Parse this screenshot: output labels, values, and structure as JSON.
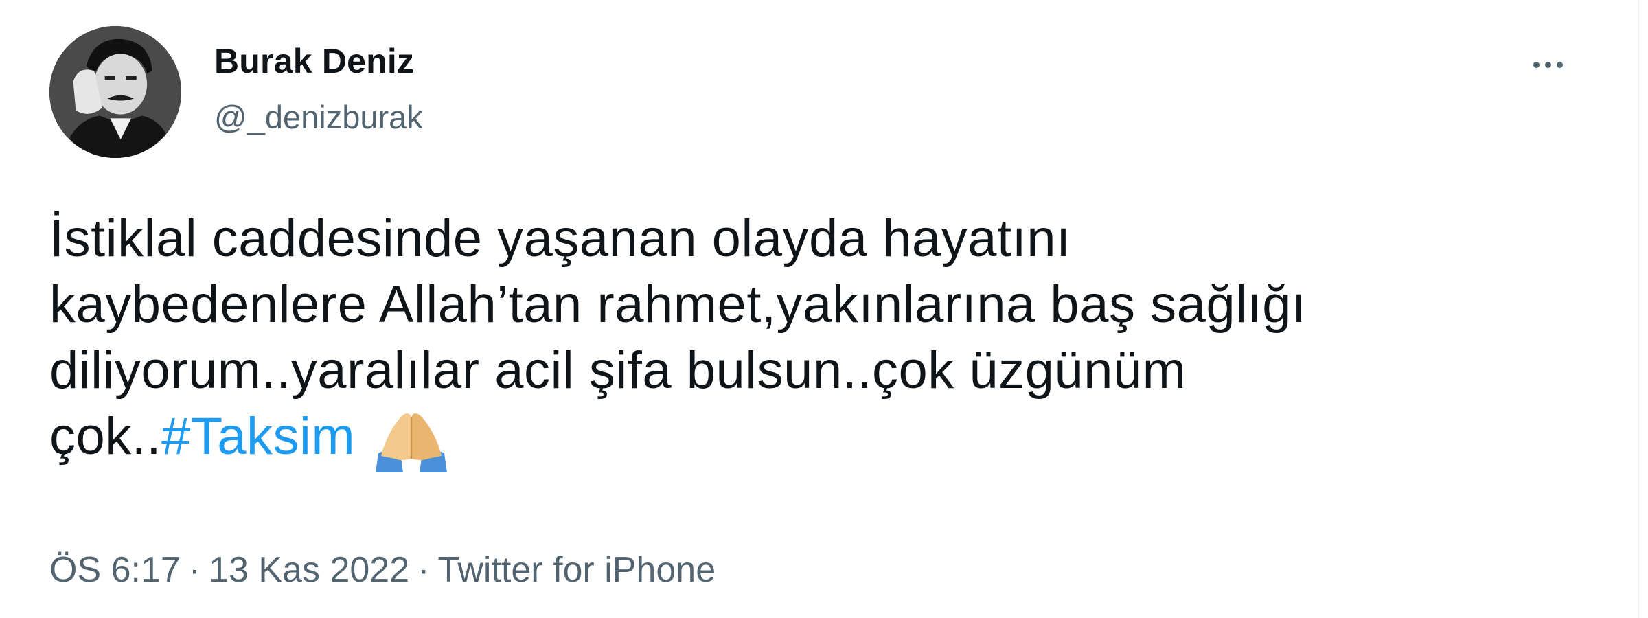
{
  "author": {
    "name": "Burak Deniz",
    "handle": "@_denizburak",
    "avatar_icon": "profile-photo"
  },
  "tweet": {
    "lines": [
      "İstiklal caddesinde yaşanan olayda hayatını",
      "kaybedenlere Allah’tan rahmet,yakınlarına baş sağlığı",
      "diliyorum..yaralılar acil şifa bulsun..çok üzgünüm"
    ],
    "last_line_prefix": "çok..",
    "hashtag": "#Taksim",
    "emoji": "folded-hands-emoji"
  },
  "meta": {
    "time": "ÖS 6:17",
    "separator": "·",
    "date": "13 Kas 2022",
    "source": "Twitter for iPhone"
  },
  "more_icon": "more-options-icon",
  "colors": {
    "text": "#0f1419",
    "secondary": "#536471",
    "link": "#1d9bf0",
    "background": "#ffffff"
  }
}
